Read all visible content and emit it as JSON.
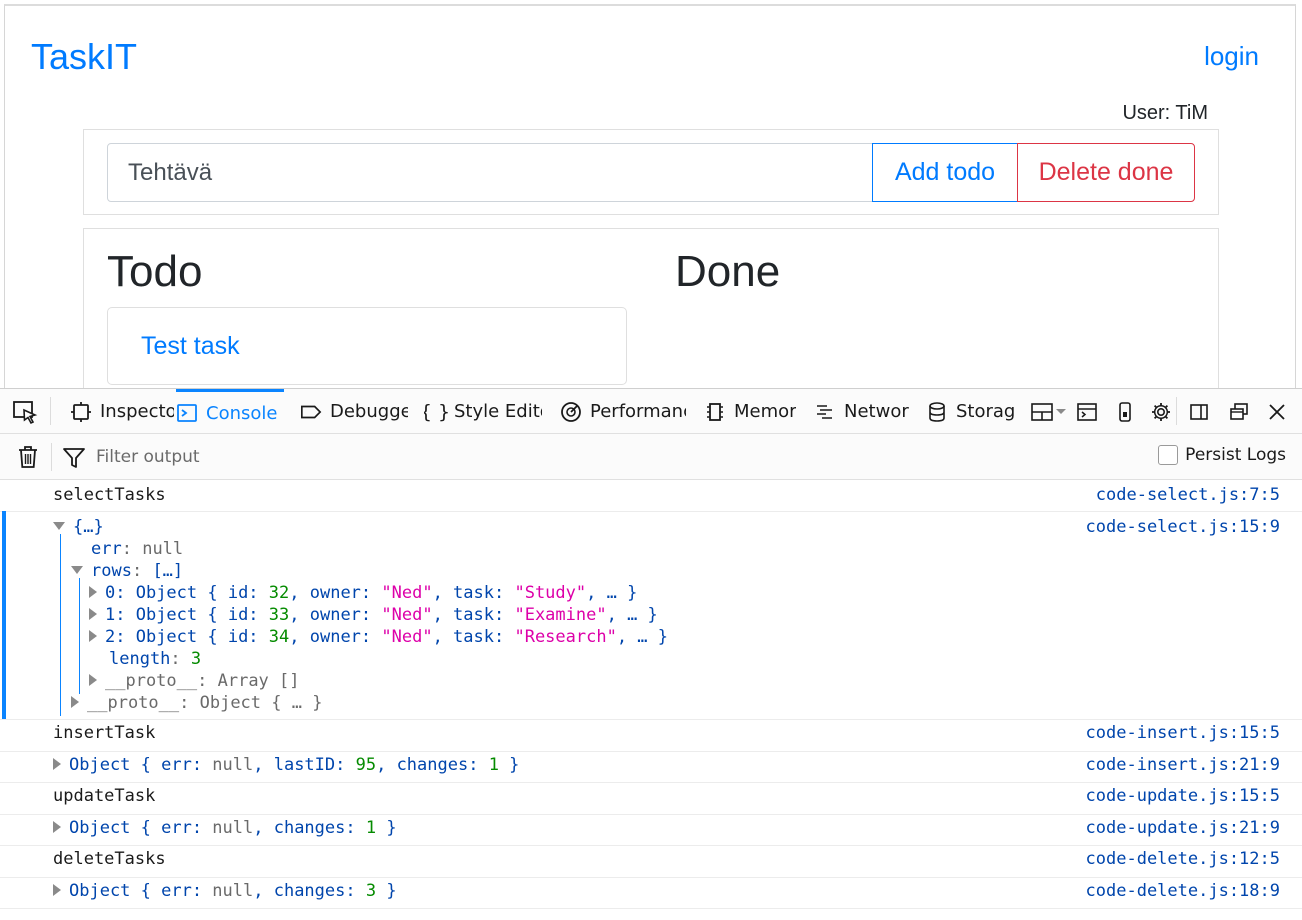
{
  "app": {
    "brand": "TaskIT",
    "login_label": "login",
    "user_line": "User: TiM",
    "task_input_placeholder": "Tehtävä",
    "add_button": "Add todo",
    "delete_button": "Delete done",
    "todo_heading": "Todo",
    "done_heading": "Done",
    "todo_items": [
      "Test task"
    ]
  },
  "devtools": {
    "tabs": [
      {
        "label": "Inspector",
        "icon": "inspector-icon"
      },
      {
        "label": "Console",
        "icon": "console-icon",
        "active": true
      },
      {
        "label": "Debugger",
        "icon": "debugger-icon"
      },
      {
        "label": "Style Editor",
        "icon": "style-editor-icon"
      },
      {
        "label": "Performance",
        "icon": "performance-icon"
      },
      {
        "label": "Memory",
        "icon": "memory-icon"
      },
      {
        "label": "Network",
        "icon": "network-icon"
      },
      {
        "label": "Storage",
        "icon": "storage-icon"
      }
    ],
    "toolbar": {
      "filter_placeholder": "Filter output",
      "persist_logs": "Persist Logs"
    },
    "active_color": "#0a84ff",
    "console": {
      "sources": {
        "s1": "code-select.js:7:5",
        "s2": "code-select.js:15:9",
        "s3": "code-insert.js:15:5",
        "s4": "code-insert.js:21:9",
        "s5": "code-update.js:15:5",
        "s6": "code-update.js:21:9",
        "s7": "code-delete.js:12:5",
        "s8": "code-delete.js:18:9"
      },
      "logs": {
        "select": "selectTasks",
        "insert": "insertTask",
        "update": "updateTask",
        "delete": "deleteTasks"
      },
      "tree": {
        "root": "{…}",
        "err_key": "err",
        "rows_key": "rows",
        "rows_preview": "[…]",
        "proto_key": "__proto__",
        "array_proto": "Array []",
        "object_proto": "Object { … }",
        "length_key": "length",
        "length_value": "3",
        "null": "null",
        "row_items": [
          {
            "index": "0",
            "id": "32",
            "owner": "\"Ned\"",
            "task": "\"Study\""
          },
          {
            "index": "1",
            "id": "33",
            "owner": "\"Ned\"",
            "task": "\"Examine\""
          },
          {
            "index": "2",
            "id": "34",
            "owner": "\"Ned\"",
            "task": "\"Research\""
          }
        ]
      },
      "results": {
        "insert": {
          "lastID": "95",
          "changes": "1"
        },
        "update": {
          "changes": "1"
        },
        "delete": {
          "changes": "3"
        }
      }
    }
  }
}
